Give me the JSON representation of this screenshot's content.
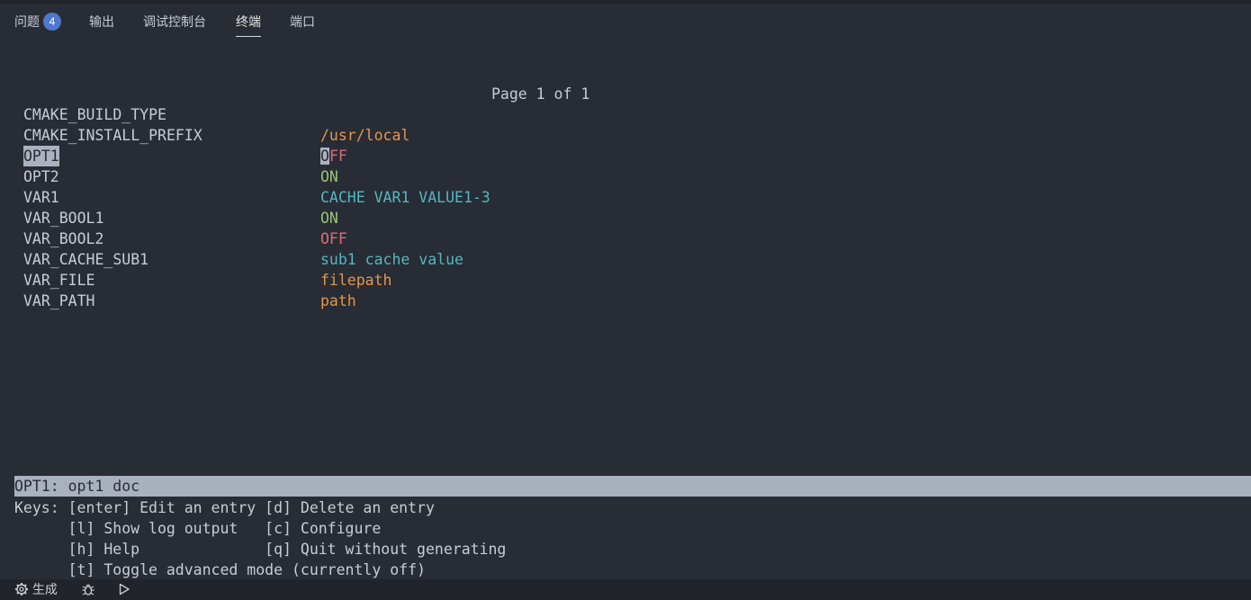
{
  "tabs": {
    "problems": {
      "label": "问题",
      "count": "4"
    },
    "output": {
      "label": "输出"
    },
    "debug_console": {
      "label": "调试控制台"
    },
    "terminal": {
      "label": "终端"
    },
    "ports": {
      "label": "端口"
    }
  },
  "terminal": {
    "page_indicator": "Page 1 of 1",
    "entries": [
      {
        "name": "CMAKE_BUILD_TYPE",
        "value": ""
      },
      {
        "name": "CMAKE_INSTALL_PREFIX",
        "value": "/usr/local"
      },
      {
        "name": "OPT1",
        "value_cursor": "O",
        "value_rest": "FF"
      },
      {
        "name": "OPT2",
        "value": "ON"
      },
      {
        "name": "VAR1",
        "value": "CACHE VAR1 VALUE1-3"
      },
      {
        "name": "VAR_BOOL1",
        "value": "ON"
      },
      {
        "name": "VAR_BOOL2",
        "value": "OFF"
      },
      {
        "name": "VAR_CACHE_SUB1",
        "value": "sub1 cache value"
      },
      {
        "name": "VAR_FILE",
        "value": "filepath"
      },
      {
        "name": "VAR_PATH",
        "value": "path"
      }
    ],
    "status_line": "OPT1: opt1 doc",
    "keys": [
      "Keys: [enter] Edit an entry [d] Delete an entry",
      "      [l] Show log output   [c] Configure",
      "      [h] Help              [q] Quit without generating",
      "      [t] Toggle advanced mode (currently off)"
    ]
  },
  "statusbar": {
    "build_label": "生成",
    "build_icon": "gear-icon",
    "debug_icon": "bug-icon",
    "run_icon": "play-icon"
  },
  "colors": {
    "background": "#282c34",
    "path_value": "#e5954e",
    "off_value": "#e06c75",
    "on_value": "#98c379",
    "string_value": "#56b6c2",
    "selection": "#abb2bf"
  }
}
